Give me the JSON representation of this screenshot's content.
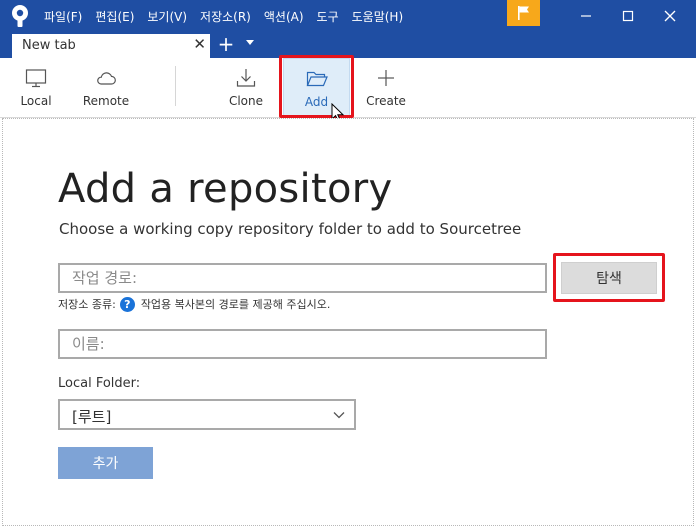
{
  "menu": {
    "items": [
      "파일(F)",
      "편집(E)",
      "보기(V)",
      "저장소(R)",
      "액션(A)",
      "도구",
      "도움말(H)"
    ]
  },
  "tabs": {
    "active_label": "New tab",
    "close_glyph": "✕",
    "add_glyph": "+"
  },
  "toolbar": {
    "items": [
      {
        "label": "Local",
        "icon": "monitor-icon"
      },
      {
        "label": "Remote",
        "icon": "cloud-icon"
      },
      {
        "label": "Clone",
        "icon": "download-icon"
      },
      {
        "label": "Add",
        "icon": "folder-open-icon",
        "active": true
      },
      {
        "label": "Create",
        "icon": "plus-icon"
      }
    ]
  },
  "main": {
    "title": "Add a repository",
    "subtitle": "Choose a working copy repository folder to add to Sourcetree",
    "path_placeholder": "작업 경로:",
    "browse_label": "탐색",
    "repo_type_label": "저장소 종류:",
    "repo_type_help": "?",
    "repo_type_message": "작업용 복사본의 경로를 제공해 주십시오.",
    "name_placeholder": "이름:",
    "local_folder_label": "Local Folder:",
    "local_folder_value": "[루트]",
    "submit_label": "추가"
  },
  "colors": {
    "titlebar": "#1f4ea3",
    "flag": "#f7a81b",
    "highlight": "#e5141c",
    "submit": "#7ea3d6",
    "help": "#1a73d9"
  }
}
